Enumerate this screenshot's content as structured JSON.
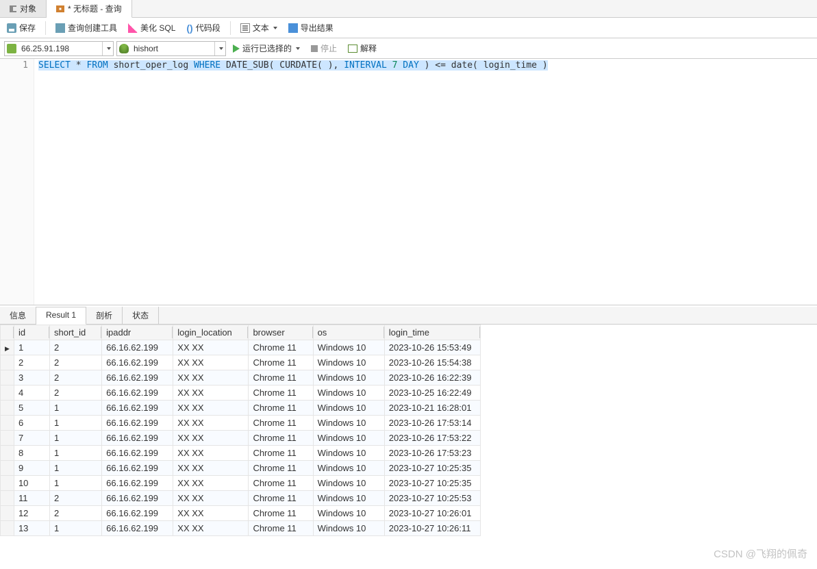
{
  "tabs_top": {
    "objects": "对象",
    "query": "* 无标题 - 查询"
  },
  "toolbar": {
    "save": "保存",
    "query_builder": "查询创建工具",
    "beautify": "美化 SQL",
    "snippet": "代码段",
    "text": "文本",
    "export": "导出结果"
  },
  "connbar": {
    "server": "66.25.91.198",
    "db": "hishort",
    "run": "运行已选择的",
    "stop": "停止",
    "explain": "解释"
  },
  "editor": {
    "line_no": "1",
    "tokens": {
      "select": "SELECT",
      "star": "*",
      "from": "FROM",
      "table": "short_oper_log",
      "where": "WHERE",
      "datesub": "DATE_SUB(",
      "curdate": "CURDATE( )",
      "comma": ",",
      "interval": "INTERVAL",
      "seven": "7",
      "day": "DAY",
      "close": ")",
      "lte": "<=",
      "datefn": "date(",
      "col": "login_time",
      "close2": ")"
    }
  },
  "result_tabs": {
    "info": "信息",
    "result1": "Result 1",
    "profile": "剖析",
    "status": "状态"
  },
  "columns": [
    "id",
    "short_id",
    "ipaddr",
    "login_location",
    "browser",
    "os",
    "login_time"
  ],
  "rows": [
    {
      "id": "1",
      "short_id": "2",
      "ipaddr": "66.16.62.199",
      "login_location": "XX XX",
      "browser": "Chrome 11",
      "os": "Windows 10",
      "login_time": "2023-10-26 15:53:49"
    },
    {
      "id": "2",
      "short_id": "2",
      "ipaddr": "66.16.62.199",
      "login_location": "XX XX",
      "browser": "Chrome 11",
      "os": "Windows 10",
      "login_time": "2023-10-26 15:54:38"
    },
    {
      "id": "3",
      "short_id": "2",
      "ipaddr": "66.16.62.199",
      "login_location": "XX XX",
      "browser": "Chrome 11",
      "os": "Windows 10",
      "login_time": "2023-10-26 16:22:39"
    },
    {
      "id": "4",
      "short_id": "2",
      "ipaddr": "66.16.62.199",
      "login_location": "XX XX",
      "browser": "Chrome 11",
      "os": "Windows 10",
      "login_time": "2023-10-25 16:22:49"
    },
    {
      "id": "5",
      "short_id": "1",
      "ipaddr": "66.16.62.199",
      "login_location": "XX XX",
      "browser": "Chrome 11",
      "os": "Windows 10",
      "login_time": "2023-10-21 16:28:01"
    },
    {
      "id": "6",
      "short_id": "1",
      "ipaddr": "66.16.62.199",
      "login_location": "XX XX",
      "browser": "Chrome 11",
      "os": "Windows 10",
      "login_time": "2023-10-26 17:53:14"
    },
    {
      "id": "7",
      "short_id": "1",
      "ipaddr": "66.16.62.199",
      "login_location": "XX XX",
      "browser": "Chrome 11",
      "os": "Windows 10",
      "login_time": "2023-10-26 17:53:22"
    },
    {
      "id": "8",
      "short_id": "1",
      "ipaddr": "66.16.62.199",
      "login_location": "XX XX",
      "browser": "Chrome 11",
      "os": "Windows 10",
      "login_time": "2023-10-26 17:53:23"
    },
    {
      "id": "9",
      "short_id": "1",
      "ipaddr": "66.16.62.199",
      "login_location": "XX XX",
      "browser": "Chrome 11",
      "os": "Windows 10",
      "login_time": "2023-10-27 10:25:35"
    },
    {
      "id": "10",
      "short_id": "1",
      "ipaddr": "66.16.62.199",
      "login_location": "XX XX",
      "browser": "Chrome 11",
      "os": "Windows 10",
      "login_time": "2023-10-27 10:25:35"
    },
    {
      "id": "11",
      "short_id": "2",
      "ipaddr": "66.16.62.199",
      "login_location": "XX XX",
      "browser": "Chrome 11",
      "os": "Windows 10",
      "login_time": "2023-10-27 10:25:53"
    },
    {
      "id": "12",
      "short_id": "2",
      "ipaddr": "66.16.62.199",
      "login_location": "XX XX",
      "browser": "Chrome 11",
      "os": "Windows 10",
      "login_time": "2023-10-27 10:26:01"
    },
    {
      "id": "13",
      "short_id": "1",
      "ipaddr": "66.16.62.199",
      "login_location": "XX XX",
      "browser": "Chrome 11",
      "os": "Windows 10",
      "login_time": "2023-10-27 10:26:11"
    }
  ],
  "watermark": "CSDN @飞翔的佩奇"
}
